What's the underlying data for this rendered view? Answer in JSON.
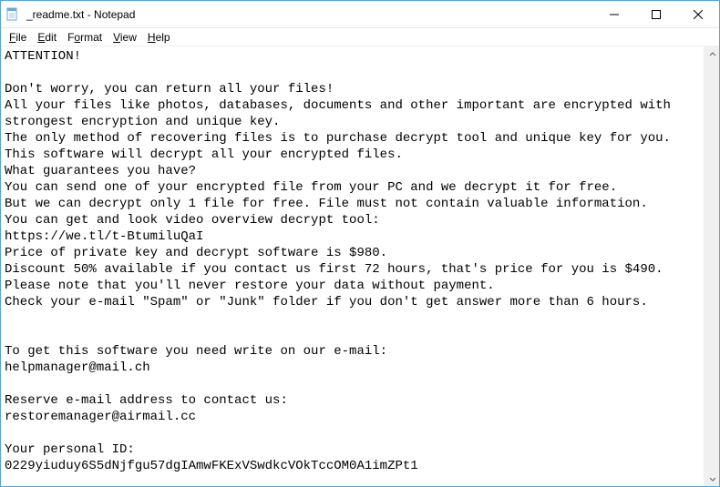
{
  "window": {
    "title": "_readme.txt - Notepad",
    "icon_name": "notepad-icon"
  },
  "menu": {
    "file": "File",
    "edit": "Edit",
    "format": "Format",
    "view": "View",
    "help": "Help"
  },
  "document": {
    "lines": [
      "ATTENTION!",
      "",
      "Don't worry, you can return all your files!",
      "All your files like photos, databases, documents and other important are encrypted with strongest encryption and unique key.",
      "The only method of recovering files is to purchase decrypt tool and unique key for you.",
      "This software will decrypt all your encrypted files.",
      "What guarantees you have?",
      "You can send one of your encrypted file from your PC and we decrypt it for free.",
      "But we can decrypt only 1 file for free. File must not contain valuable information.",
      "You can get and look video overview decrypt tool:",
      "https://we.tl/t-BtumiluQaI",
      "Price of private key and decrypt software is $980.",
      "Discount 50% available if you contact us first 72 hours, that's price for you is $490.",
      "Please note that you'll never restore your data without payment.",
      "Check your e-mail \"Spam\" or \"Junk\" folder if you don't get answer more than 6 hours.",
      "",
      "",
      "To get this software you need write on our e-mail:",
      "helpmanager@mail.ch",
      "",
      "Reserve e-mail address to contact us:",
      "restoremanager@airmail.cc",
      "",
      "Your personal ID:",
      "0229yiuduy6S5dNjfgu57dgIAmwFKExVSwdkcVOkTccOM0A1imZPt1"
    ]
  }
}
